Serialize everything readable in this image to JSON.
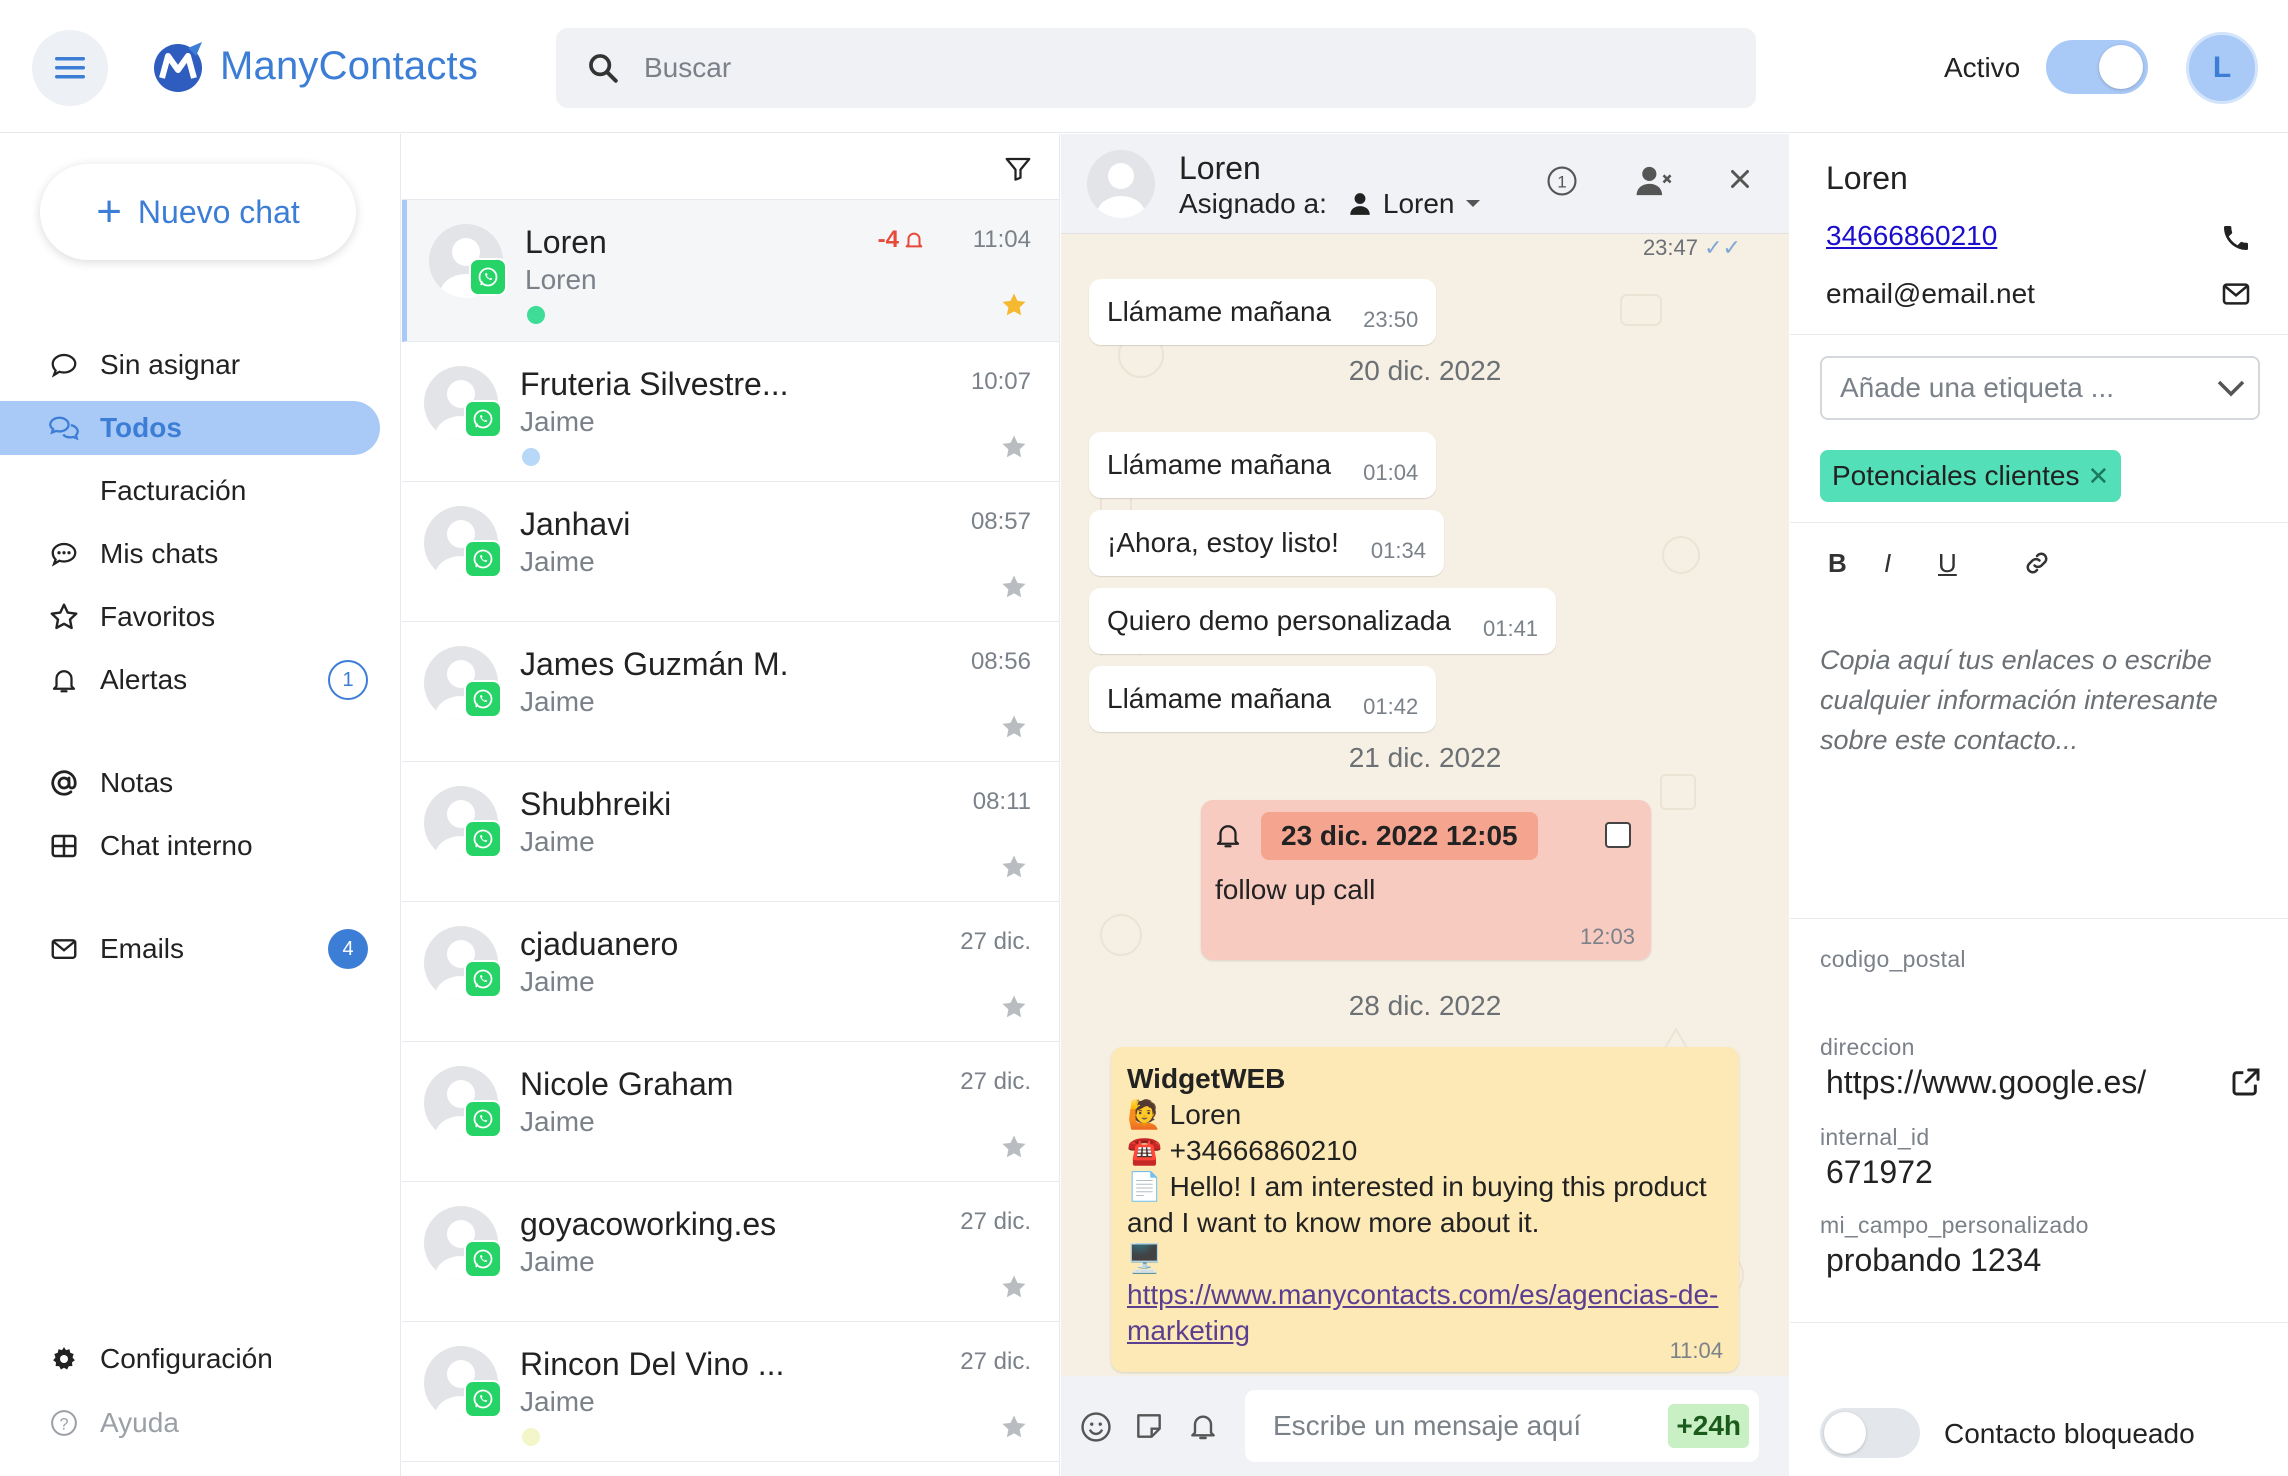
{
  "app": {
    "name": "ManyContacts"
  },
  "header": {
    "search_placeholder": "Buscar",
    "status_label": "Activo",
    "status_on": true,
    "user_initial": "L",
    "colors": {
      "accent": "#3c7ed6",
      "accent_light": "#a9c9f6"
    }
  },
  "sidebar": {
    "new_chat_label": "Nuevo chat",
    "items": [
      {
        "label": "Sin asignar",
        "icon": "chat-bubble-icon"
      },
      {
        "label": "Todos",
        "icon": "chats-icon",
        "active": true
      },
      {
        "label": "Facturación",
        "icon": ""
      },
      {
        "label": "Mis chats",
        "icon": "chat-dots-icon"
      },
      {
        "label": "Favoritos",
        "icon": "star-icon"
      },
      {
        "label": "Alertas",
        "icon": "bell-icon",
        "badge": "1"
      },
      {
        "label": "Notas",
        "icon": "at-icon"
      },
      {
        "label": "Chat interno",
        "icon": "grid-icon"
      },
      {
        "label": "Emails",
        "icon": "mail-icon",
        "badge": "4"
      }
    ],
    "settings_label": "Configuración",
    "help_label": "Ayuda"
  },
  "chat_list": [
    {
      "name": "Loren",
      "sub": "Loren",
      "time": "11:04",
      "alert": "-4",
      "starred": true,
      "dot": "#3ddc97",
      "selected": true
    },
    {
      "name": "Fruteria Silvestre...",
      "sub": "Jaime",
      "time": "10:07",
      "starred": false,
      "dot": "#b7d8f7"
    },
    {
      "name": "Janhavi",
      "sub": "Jaime",
      "time": "08:57",
      "starred": false
    },
    {
      "name": "James Guzmán M.",
      "sub": "Jaime",
      "time": "08:56",
      "starred": false
    },
    {
      "name": "Shubhreiki",
      "sub": "Jaime",
      "time": "08:11",
      "starred": false
    },
    {
      "name": "cjaduanero",
      "sub": "Jaime",
      "time": "27 dic.",
      "starred": false
    },
    {
      "name": "Nicole Graham",
      "sub": "Jaime",
      "time": "27 dic.",
      "starred": false
    },
    {
      "name": "goyacoworking.es",
      "sub": "Jaime",
      "time": "27 dic.",
      "starred": false
    },
    {
      "name": "Rincon Del Vino ...",
      "sub": "Jaime",
      "time": "27 dic.",
      "starred": false,
      "dot": "#f3f6c8"
    }
  ],
  "conversation": {
    "contact_name": "Loren",
    "assigned_label": "Asignado a:",
    "assigned_to": "Loren",
    "top_time": "23:47",
    "messages": [
      {
        "text": "Llámame mañana",
        "time": "23:50"
      },
      {
        "date": "20 dic. 2022"
      },
      {
        "text": "Llámame mañana",
        "time": "01:04"
      },
      {
        "text": "¡Ahora, estoy listo!",
        "time": "01:34"
      },
      {
        "text": "Quiero demo personalizada",
        "time": "01:41"
      },
      {
        "text": "Llámame mañana",
        "time": "01:42"
      },
      {
        "date": "21 dic. 2022"
      },
      {
        "date": "28 dic. 2022"
      }
    ],
    "reminder": {
      "datetime": "23 dic. 2022 12:05",
      "text": "follow up call",
      "time": "12:03"
    },
    "widget": {
      "title": "WidgetWEB",
      "line_name": "🙋 Loren",
      "line_phone": "☎️ +34666860210",
      "line_msg": "📄 Hello! I am interested in buying this product and I want to know more about it.",
      "line_pc": "🖥️",
      "link": "https://www.manycontacts.com/es/agencias-de-marketing",
      "time": "11:04"
    },
    "input_placeholder": "Escribe un mensaje aquí",
    "window_label": "+24h"
  },
  "details": {
    "name": "Loren",
    "phone": "34666860210",
    "email": "email@email.net",
    "tag_placeholder": "Añade una etiqueta ...",
    "tag": "Potenciales clientes",
    "tag_color": "#53e0b8",
    "format_buttons": [
      "B",
      "I",
      "U"
    ],
    "notes_placeholder": "Copia aquí tus enlaces o escribe cualquier información interesante sobre este contacto...",
    "fields": [
      {
        "label": "codigo_postal",
        "value": ""
      },
      {
        "label": "direccion",
        "value": "https://www.google.es/"
      },
      {
        "label": "internal_id",
        "value": "671972"
      },
      {
        "label": "mi_campo_personalizado",
        "value": "probando 1234"
      }
    ],
    "blocked_label": "Contacto bloqueado",
    "blocked": false
  }
}
